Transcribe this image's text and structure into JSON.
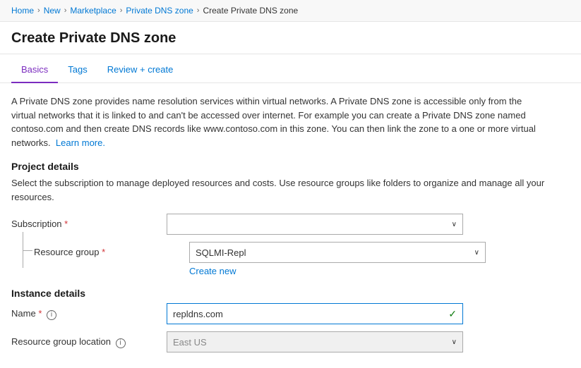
{
  "breadcrumb": {
    "items": [
      {
        "label": "Home",
        "link": true
      },
      {
        "label": "New",
        "link": true
      },
      {
        "label": "Marketplace",
        "link": true
      },
      {
        "label": "Private DNS zone",
        "link": true
      },
      {
        "label": "Create Private DNS zone",
        "link": false
      }
    ]
  },
  "pageTitle": "Create Private DNS zone",
  "tabs": [
    {
      "label": "Basics",
      "active": true
    },
    {
      "label": "Tags",
      "active": false
    },
    {
      "label": "Review + create",
      "active": false
    }
  ],
  "description": {
    "text": "A Private DNS zone provides name resolution services within virtual networks. A Private DNS zone is accessible only from the virtual networks that it is linked to and can't be accessed over internet. For example you can create a Private DNS zone named contoso.com and then create DNS records like www.contoso.com in this zone. You can then link the zone to a one or more virtual networks.",
    "learnMoreLabel": "Learn more."
  },
  "projectDetails": {
    "title": "Project details",
    "description": "Select the subscription to manage deployed resources and costs. Use resource groups like folders to organize and manage all your resources.",
    "subscriptionLabel": "Subscription",
    "subscriptionRequired": true,
    "subscriptionValue": "",
    "resourceGroupLabel": "Resource group",
    "resourceGroupRequired": true,
    "resourceGroupValue": "SQLMI-Repl",
    "createNewLabel": "Create new"
  },
  "instanceDetails": {
    "title": "Instance details",
    "nameLabel": "Name",
    "nameRequired": true,
    "nameValue": "repldns.com",
    "resourceGroupLocationLabel": "Resource group location",
    "resourceGroupLocationValue": "East US"
  },
  "icons": {
    "chevron": "∨",
    "check": "✓",
    "info": "i",
    "breadcrumbSep": "›"
  }
}
